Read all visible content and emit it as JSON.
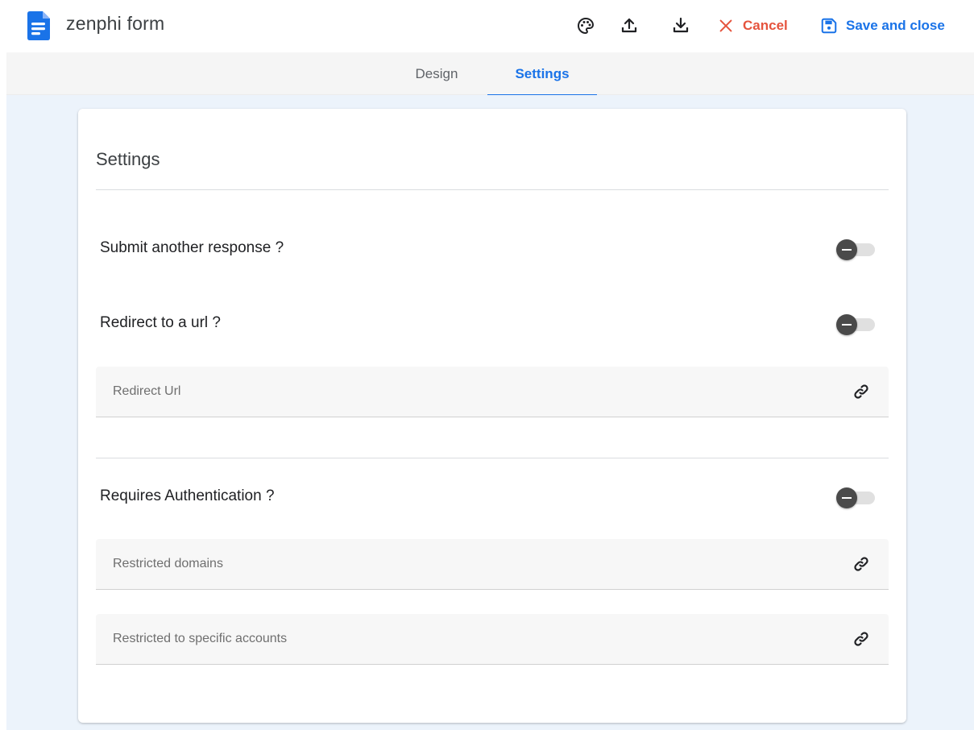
{
  "header": {
    "app_title": "zenphi form",
    "icons": [
      "form-document-icon",
      "palette-icon",
      "upload-icon",
      "download-icon",
      "close-icon",
      "save-icon",
      "link-icon"
    ],
    "cancel_label": "Cancel",
    "save_label": "Save and close",
    "colors": {
      "logo": "#1a73e8",
      "cancel": "#e5533d",
      "save": "#1a73e8"
    }
  },
  "tabs": [
    {
      "label": "Design",
      "active": false
    },
    {
      "label": "Settings",
      "active": true
    }
  ],
  "settings": {
    "title": "Settings",
    "submit_another": {
      "label": "Submit another response ?",
      "enabled": false
    },
    "redirect": {
      "label": "Redirect to a url ?",
      "enabled": false
    },
    "redirect_url": {
      "placeholder": "Redirect Url",
      "value": ""
    },
    "requires_auth": {
      "label": "Requires Authentication ?",
      "enabled": false
    },
    "restricted_domains": {
      "placeholder": "Restricted domains",
      "value": ""
    },
    "restricted_accounts": {
      "placeholder": "Restricted to specific accounts",
      "value": ""
    }
  },
  "colors": {
    "page_background": "#ecf3fb",
    "tabbar_background": "#f5f5f5",
    "active_tab": "#1a73e8"
  }
}
